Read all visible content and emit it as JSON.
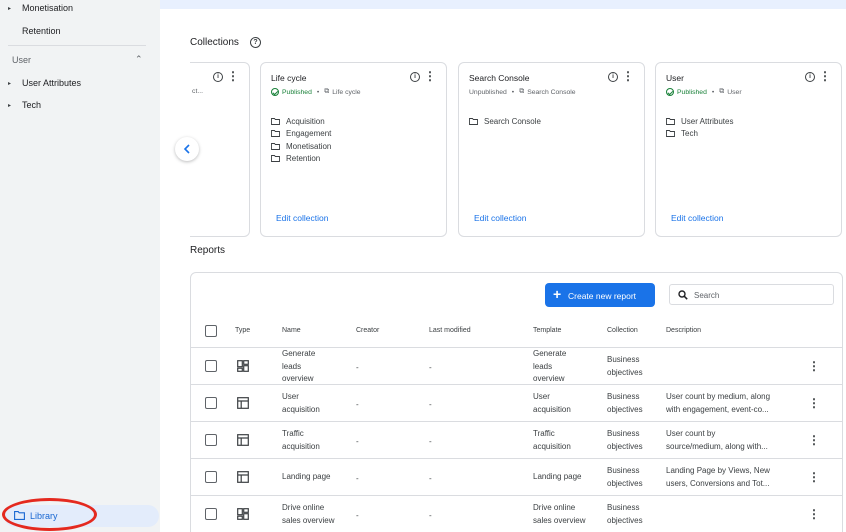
{
  "sidebar": {
    "items": [
      {
        "label": "Monetisation",
        "caret": "▸"
      },
      {
        "label": "Retention",
        "caret": ""
      }
    ],
    "section": {
      "label": "User",
      "chevron": "⌃"
    },
    "section_items": [
      {
        "label": "User Attributes",
        "caret": "▸"
      },
      {
        "label": "Tech",
        "caret": "▸"
      }
    ],
    "library_label": "Library"
  },
  "collections": {
    "title": "Collections",
    "help_glyph": "?",
    "partial_card": {
      "meta": "ct..."
    },
    "cards": [
      {
        "title": "Life cycle",
        "status": "Published",
        "template": "Life cycle",
        "folders": [
          "Acquisition",
          "Engagement",
          "Monetisation",
          "Retention"
        ],
        "edit": "Edit collection"
      },
      {
        "title": "Search Console",
        "status": "Unpublished",
        "template": "Search Console",
        "folders": [
          "Search Console"
        ],
        "edit": "Edit collection"
      },
      {
        "title": "User",
        "status": "Published",
        "template": "User",
        "folders": [
          "User Attributes",
          "Tech"
        ],
        "edit": "Edit collection"
      }
    ],
    "info_glyph": "i",
    "kebab_glyph": "⋮",
    "dot": "•",
    "template_glyph": "⧉"
  },
  "reports": {
    "title": "Reports",
    "create_label": "Create new report",
    "plus_glyph": "+",
    "search_placeholder": "Search",
    "columns": [
      "Type",
      "Name",
      "Creator",
      "Last modified",
      "Template",
      "Collection",
      "Description"
    ],
    "rows": [
      {
        "type_icon": "dashboard-icon",
        "name": "Generate\nleads\noverview",
        "creator": "-",
        "modified": "-",
        "template": "Generate\nleads\noverview",
        "collection": "Business\nobjectives",
        "description": ""
      },
      {
        "type_icon": "table-icon",
        "name": "User\nacquisition",
        "creator": "-",
        "modified": "-",
        "template": "User\nacquisition",
        "collection": "Business\nobjectives",
        "description": "User count by medium, along\nwith engagement, event-co..."
      },
      {
        "type_icon": "table-icon",
        "name": "Traffic\nacquisition",
        "creator": "-",
        "modified": "-",
        "template": "Traffic\nacquisition",
        "collection": "Business\nobjectives",
        "description": "User count by\nsource/medium, along with..."
      },
      {
        "type_icon": "table-icon",
        "name": "Landing page",
        "creator": "-",
        "modified": "-",
        "template": "Landing page",
        "collection": "Business\nobjectives",
        "description": "Landing Page by Views, New\nusers, Conversions and Tot..."
      },
      {
        "type_icon": "dashboard-icon",
        "name": "Drive online\nsales overview",
        "creator": "-",
        "modified": "-",
        "template": "Drive online\nsales overview",
        "collection": "Business\nobjectives",
        "description": ""
      }
    ]
  },
  "colors": {
    "accent": "#1a73e8",
    "published": "#188038",
    "highlight": "#e4291f"
  }
}
